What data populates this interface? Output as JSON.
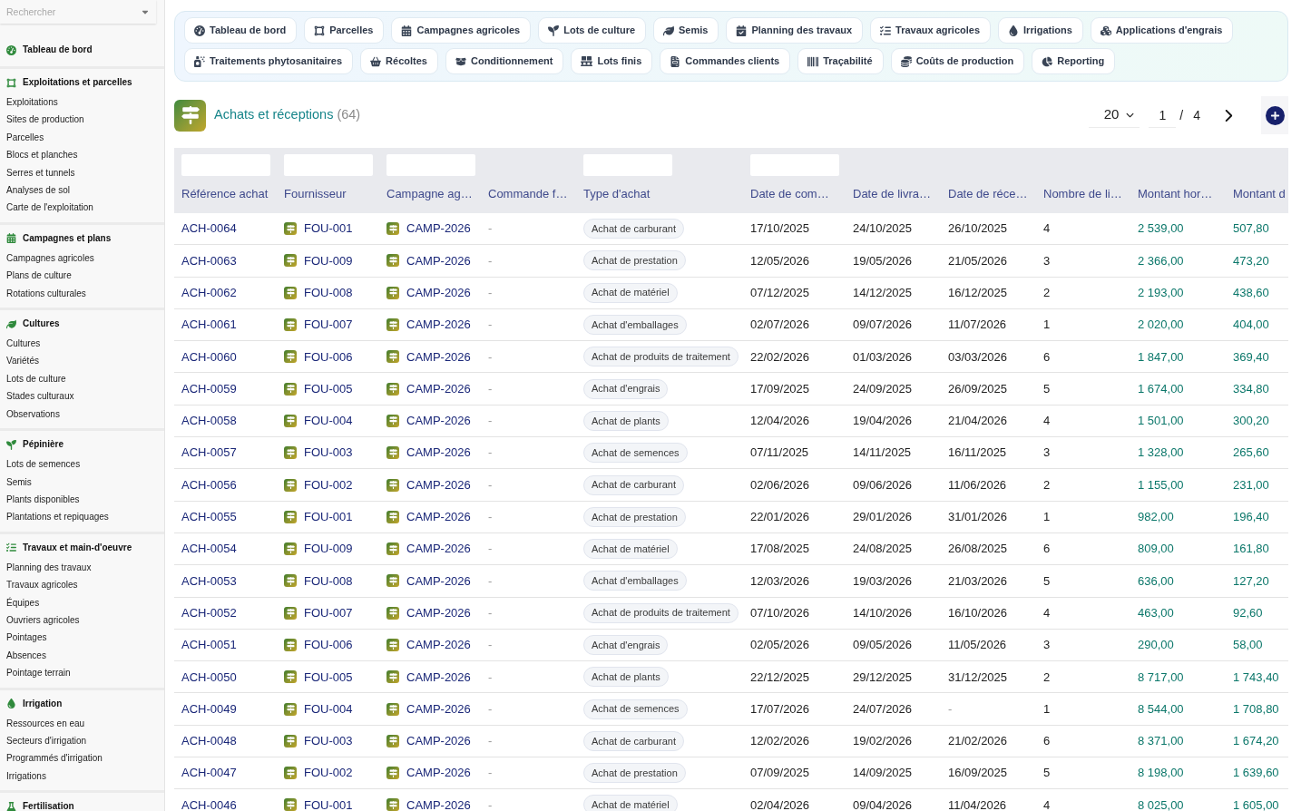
{
  "sidebar": {
    "search": {
      "placeholder": "Rechercher"
    },
    "sections": [
      {
        "title": "Tableau de bord"
      },
      {
        "title": "Exploitations et parcelles",
        "items": [
          "Exploitations",
          "Sites de production",
          "Parcelles",
          "Blocs et planches",
          "Serres et tunnels",
          "Analyses de sol",
          "Carte de l'exploitation"
        ]
      },
      {
        "title": "Campagnes et plans",
        "items": [
          "Campagnes agricoles",
          "Plans de culture",
          "Rotations culturales"
        ]
      },
      {
        "title": "Cultures",
        "items": [
          "Cultures",
          "Variétés",
          "Lots de culture",
          "Stades culturaux",
          "Observations"
        ]
      },
      {
        "title": "Pépinière",
        "items": [
          "Lots de semences",
          "Semis",
          "Plants disponibles",
          "Plantations et repiquages"
        ]
      },
      {
        "title": "Travaux et main-d'oeuvre",
        "items": [
          "Planning des travaux",
          "Travaux agricoles",
          "Équipes",
          "Ouvriers agricoles",
          "Pointages",
          "Absences",
          "Pointage terrain"
        ]
      },
      {
        "title": "Irrigation",
        "items": [
          "Ressources en eau",
          "Secteurs d'irrigation",
          "Programmés d'irrigation",
          "Irrigations"
        ]
      },
      {
        "title": "Fertilisation"
      }
    ]
  },
  "quick_links": [
    "Tableau de bord",
    "Parcelles",
    "Campagnes agricoles",
    "Lots de culture",
    "Semis",
    "Planning des travaux",
    "Travaux agricoles",
    "Irrigations",
    "Applications d'engrais",
    "Traitements phytosanitaires",
    "Récoltes",
    "Conditionnement",
    "Lots finis",
    "Commandes clients",
    "Traçabilité",
    "Coûts de production",
    "Reporting"
  ],
  "page_header": {
    "title": "Achats et réceptions",
    "count": "(64)"
  },
  "pagination": {
    "page_size": "20",
    "page": "1",
    "separator": "/",
    "total_pages": "4"
  },
  "table": {
    "columns": [
      {
        "label": "Référence achat",
        "kind": "link",
        "filter": true
      },
      {
        "label": "Fournisseur",
        "kind": "entity",
        "filter": true
      },
      {
        "label": "Campagne ag…",
        "kind": "entity",
        "filter": true
      },
      {
        "label": "Commande f…",
        "kind": "muted"
      },
      {
        "label": "Type d'achat",
        "kind": "badge",
        "filter": true
      },
      {
        "label": "Date de com…",
        "kind": "text",
        "filter": true
      },
      {
        "label": "Date de livra…",
        "kind": "text"
      },
      {
        "label": "Date de réce…",
        "kind": "text"
      },
      {
        "label": "Nombre de li…",
        "kind": "text"
      },
      {
        "label": "Montant hor…",
        "kind": "amount"
      },
      {
        "label": "Montant d",
        "kind": "amount"
      }
    ],
    "rows": [
      [
        "ACH-0064",
        "FOU-001",
        "CAMP-2026",
        "-",
        "Achat de carburant",
        "17/10/2025",
        "24/10/2025",
        "26/10/2025",
        "4",
        "2 539,00",
        "507,80"
      ],
      [
        "ACH-0063",
        "FOU-009",
        "CAMP-2026",
        "-",
        "Achat de prestation",
        "12/05/2026",
        "19/05/2026",
        "21/05/2026",
        "3",
        "2 366,00",
        "473,20"
      ],
      [
        "ACH-0062",
        "FOU-008",
        "CAMP-2026",
        "-",
        "Achat de matériel",
        "07/12/2025",
        "14/12/2025",
        "16/12/2025",
        "2",
        "2 193,00",
        "438,60"
      ],
      [
        "ACH-0061",
        "FOU-007",
        "CAMP-2026",
        "-",
        "Achat d'emballages",
        "02/07/2026",
        "09/07/2026",
        "11/07/2026",
        "1",
        "2 020,00",
        "404,00"
      ],
      [
        "ACH-0060",
        "FOU-006",
        "CAMP-2026",
        "-",
        "Achat de produits de traitement",
        "22/02/2026",
        "01/03/2026",
        "03/03/2026",
        "6",
        "1 847,00",
        "369,40"
      ],
      [
        "ACH-0059",
        "FOU-005",
        "CAMP-2026",
        "-",
        "Achat d'engrais",
        "17/09/2025",
        "24/09/2025",
        "26/09/2025",
        "5",
        "1 674,00",
        "334,80"
      ],
      [
        "ACH-0058",
        "FOU-004",
        "CAMP-2026",
        "-",
        "Achat de plants",
        "12/04/2026",
        "19/04/2026",
        "21/04/2026",
        "4",
        "1 501,00",
        "300,20"
      ],
      [
        "ACH-0057",
        "FOU-003",
        "CAMP-2026",
        "-",
        "Achat de semences",
        "07/11/2025",
        "14/11/2025",
        "16/11/2025",
        "3",
        "1 328,00",
        "265,60"
      ],
      [
        "ACH-0056",
        "FOU-002",
        "CAMP-2026",
        "-",
        "Achat de carburant",
        "02/06/2026",
        "09/06/2026",
        "11/06/2026",
        "2",
        "1 155,00",
        "231,00"
      ],
      [
        "ACH-0055",
        "FOU-001",
        "CAMP-2026",
        "-",
        "Achat de prestation",
        "22/01/2026",
        "29/01/2026",
        "31/01/2026",
        "1",
        "982,00",
        "196,40"
      ],
      [
        "ACH-0054",
        "FOU-009",
        "CAMP-2026",
        "-",
        "Achat de matériel",
        "17/08/2025",
        "24/08/2025",
        "26/08/2025",
        "6",
        "809,00",
        "161,80"
      ],
      [
        "ACH-0053",
        "FOU-008",
        "CAMP-2026",
        "-",
        "Achat d'emballages",
        "12/03/2026",
        "19/03/2026",
        "21/03/2026",
        "5",
        "636,00",
        "127,20"
      ],
      [
        "ACH-0052",
        "FOU-007",
        "CAMP-2026",
        "-",
        "Achat de produits de traitement",
        "07/10/2026",
        "14/10/2026",
        "16/10/2026",
        "4",
        "463,00",
        "92,60"
      ],
      [
        "ACH-0051",
        "FOU-006",
        "CAMP-2026",
        "-",
        "Achat d'engrais",
        "02/05/2026",
        "09/05/2026",
        "11/05/2026",
        "3",
        "290,00",
        "58,00"
      ],
      [
        "ACH-0050",
        "FOU-005",
        "CAMP-2026",
        "-",
        "Achat de plants",
        "22/12/2025",
        "29/12/2025",
        "31/12/2025",
        "2",
        "8 717,00",
        "1 743,40"
      ],
      [
        "ACH-0049",
        "FOU-004",
        "CAMP-2026",
        "-",
        "Achat de semences",
        "17/07/2026",
        "24/07/2026",
        {
          "text": "-",
          "kind": "empty"
        },
        "1",
        "8 544,00",
        "1 708,80"
      ],
      [
        "ACH-0048",
        "FOU-003",
        "CAMP-2026",
        "-",
        "Achat de carburant",
        "12/02/2026",
        "19/02/2026",
        "21/02/2026",
        "6",
        "8 371,00",
        "1 674,20"
      ],
      [
        "ACH-0047",
        "FOU-002",
        "CAMP-2026",
        "-",
        "Achat de prestation",
        "07/09/2025",
        "14/09/2025",
        "16/09/2025",
        "5",
        "8 198,00",
        "1 639,60"
      ],
      [
        "ACH-0046",
        "FOU-001",
        "CAMP-2026",
        "-",
        "Achat de matériel",
        "02/04/2026",
        "09/04/2026",
        "11/04/2026",
        "4",
        "8 025,00",
        "1 605,00"
      ]
    ]
  }
}
